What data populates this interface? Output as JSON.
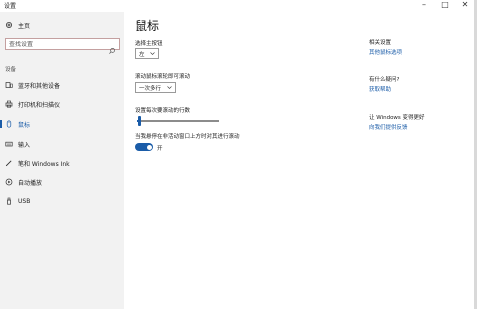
{
  "window": {
    "title": "设置",
    "min_symbol": "–",
    "max_symbol": "□",
    "close_symbol": "✕"
  },
  "sidebar": {
    "home_label": "主页",
    "search_placeholder": "查找设置",
    "section_label": "设备",
    "items": [
      {
        "label": "蓝牙和其他设备",
        "icon": "bluetooth-device-icon"
      },
      {
        "label": "打印机和扫描仪",
        "icon": "printer-icon"
      },
      {
        "label": "鼠标",
        "icon": "mouse-icon"
      },
      {
        "label": "输入",
        "icon": "keyboard-icon"
      },
      {
        "label": "笔和 Windows Ink",
        "icon": "pen-icon"
      },
      {
        "label": "自动播放",
        "icon": "autoplay-icon"
      },
      {
        "label": "USB",
        "icon": "usb-icon"
      }
    ],
    "active_item": "鼠标"
  },
  "main": {
    "title": "鼠标",
    "primary_button": {
      "label": "选择主按钮",
      "value": "左"
    },
    "scroll_wheel": {
      "label": "滚动鼠标滚轮即可滚动",
      "value": "一次多行"
    },
    "lines_to_scroll": {
      "label": "设置每次要滚动的行数",
      "level": 0.03
    },
    "inactive_scroll": {
      "label": "当我悬停在非活动窗口上方时对其进行滚动",
      "state": "开",
      "on": true
    }
  },
  "related": {
    "heading": "相关设置",
    "link": "其他鼠标选项",
    "help_heading": "有什么疑问?",
    "help_link": "获取帮助",
    "better_heading": "让 Windows 变得更好",
    "feedback_link": "向我们提供反馈"
  },
  "colors": {
    "accent": "#1b5ca8",
    "sidebar_bg": "#f2f2f2"
  }
}
